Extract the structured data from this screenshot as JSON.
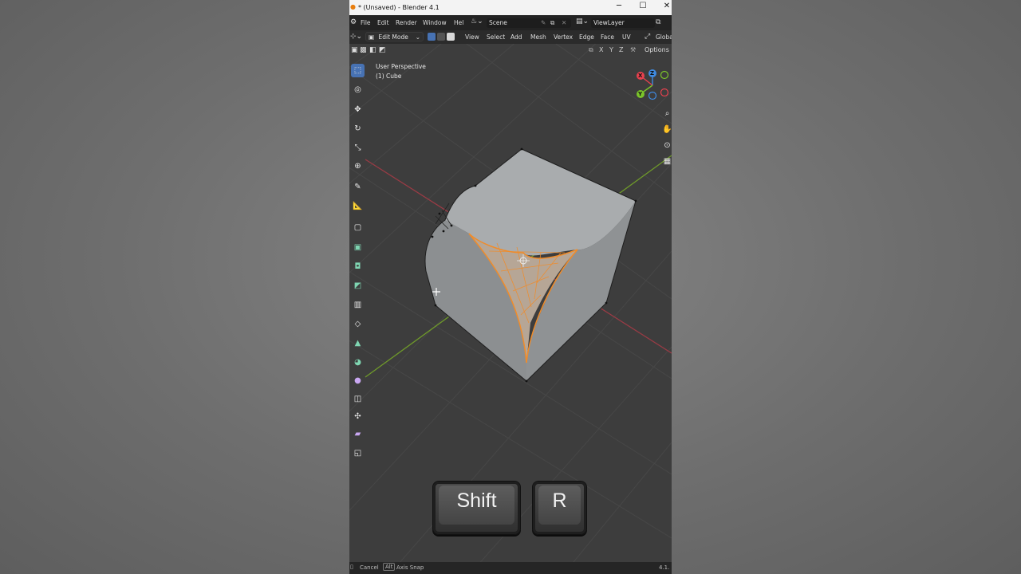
{
  "window": {
    "title": "* (Unsaved) - Blender 4.1",
    "controls": {
      "minimize": "─",
      "maximize": "☐",
      "close": "✕"
    }
  },
  "menu": {
    "items": [
      "File",
      "Edit",
      "Render",
      "Window",
      "Help"
    ],
    "scene_label": "Scene",
    "viewlayer_label": "ViewLayer"
  },
  "header": {
    "mode_label": "Edit Mode",
    "menus": [
      "View",
      "Select",
      "Add",
      "Mesh",
      "Vertex",
      "Edge",
      "Face",
      "UV"
    ],
    "transform_orientation": "Global"
  },
  "options_bar": {
    "axes": [
      "X",
      "Y",
      "Z"
    ],
    "options_label": "Options"
  },
  "viewport": {
    "perspective_label": "User Perspective",
    "object_label": "(1) Cube"
  },
  "gizmo": {
    "x": "X",
    "y": "Y",
    "z": "Z"
  },
  "keys": {
    "shift": "Shift",
    "r": "R"
  },
  "statusbar": {
    "cancel": "Cancel",
    "alt_key": "Alt",
    "axis_snap": "Axis Snap",
    "version": "4.1."
  },
  "colors": {
    "selection": "#f08c2a",
    "active_tool": "#4772b3",
    "axis_x": "#e8414e",
    "axis_y": "#7bc42a",
    "axis_z": "#3f8ae0"
  }
}
